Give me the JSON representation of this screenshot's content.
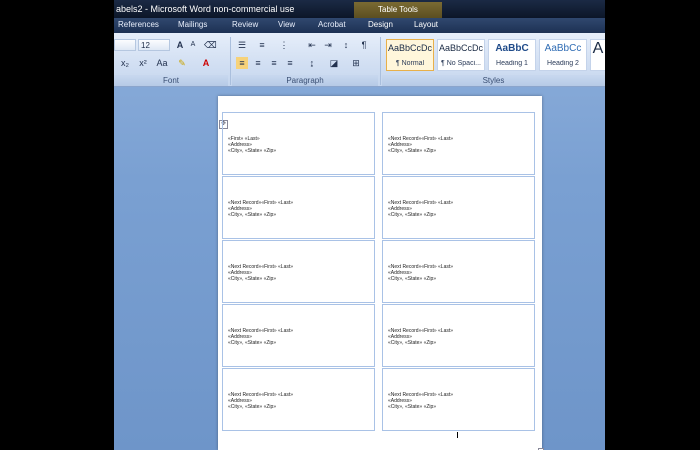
{
  "window": {
    "title": "abels2 - Microsoft Word non-commercial use",
    "context_tab": "Table Tools"
  },
  "tabs": [
    "References",
    "Mailings",
    "Review",
    "View",
    "Acrobat",
    "Design",
    "Layout"
  ],
  "ribbon": {
    "font_size": "12",
    "groups": {
      "font": "Font",
      "paragraph": "Paragraph",
      "styles": "Styles"
    },
    "font_buttons": [
      "A",
      "A",
      "x₂",
      "x²",
      "Aa"
    ],
    "styles": [
      {
        "preview": "AaBbCcDc",
        "name": "¶ Normal"
      },
      {
        "preview": "AaBbCcDc",
        "name": "¶ No Spaci..."
      },
      {
        "preview": "AaBbC",
        "name": "Heading 1"
      },
      {
        "preview": "AaBbCc",
        "name": "Heading 2"
      },
      {
        "preview": "A",
        "name": ""
      }
    ]
  },
  "labels": {
    "first": {
      "line1": "«First» «Last»",
      "line2": "«Address»",
      "line3": "«City», «State» «Zip»"
    },
    "next": {
      "line1": "«Next Record»«First» «Last»",
      "line2": "«Address»",
      "line3": "«City», «State» «Zip»"
    }
  },
  "colors": {
    "accent": "#e8b04a",
    "background": "#7aa0d2",
    "grid": "#a9c2e6"
  }
}
